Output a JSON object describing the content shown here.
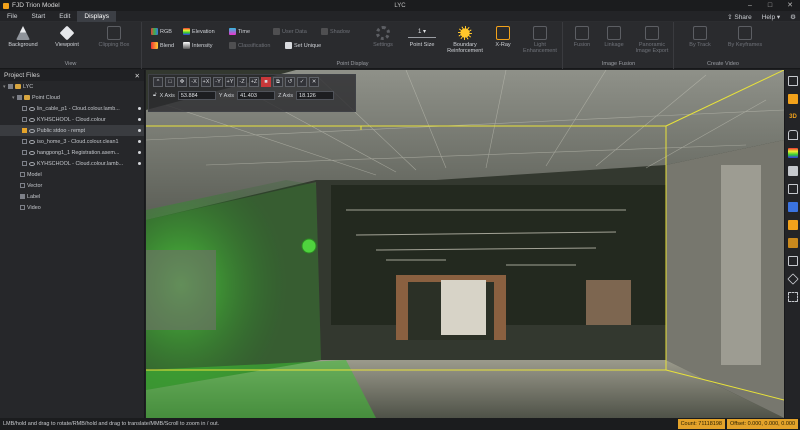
{
  "window": {
    "app_name": "FJD Trion Model",
    "title": "LYC"
  },
  "menu": {
    "items": [
      "File",
      "Start",
      "Edit",
      "Displays"
    ],
    "active": "Displays",
    "share": "Share",
    "help": "Help"
  },
  "ribbon": {
    "view": {
      "label": "View",
      "background": "Background",
      "viewpoint": "Viewpoint",
      "clipping_box": "Clipping Box"
    },
    "point_display": {
      "label": "Point Display",
      "rgb": "RGB",
      "elevation": "Elevation",
      "time": "Time",
      "user_data": "User Data",
      "shadow": "Shadow",
      "blend": "Blend",
      "intensity": "Intensity",
      "classification": "Classification",
      "set_unique": "Set Unique",
      "settings": "Settings",
      "point_size_value": "1",
      "point_size": "Point Size",
      "boundary_reinforcement": "Boundary Reinforcement",
      "xray": "X-Ray",
      "light_enhancement": "Light Enhancement"
    },
    "image_fusion": {
      "label": "Image Fusion",
      "fusion": "Fusion",
      "linkage": "Linkage",
      "panoramic_image_export": "Panoramic Image Export"
    },
    "create_video": {
      "label": "Create Video",
      "by_track": "By Track",
      "by_keyframes": "By Keyframes"
    }
  },
  "project_files": {
    "title": "Project Files",
    "rows": [
      {
        "label": "LYC",
        "depth": 0
      },
      {
        "label": "Point Cloud",
        "depth": 1
      },
      {
        "label": "lin_cable_p1 - Cloud.colour.lamb...",
        "depth": 2
      },
      {
        "label": "KYHSCHOOL - Cloud.colour",
        "depth": 2
      },
      {
        "label": "Public stdoo - rempt",
        "depth": 2
      },
      {
        "label": "iso_home_3 - Cloud.colour.clean1",
        "depth": 2
      },
      {
        "label": "hangpong1_1 Registration.asem...",
        "depth": 2
      },
      {
        "label": "KYHSCHOOL - Cloud.colour.lamb...",
        "depth": 2
      },
      {
        "label": "Model",
        "depth": 1
      },
      {
        "label": "Vector",
        "depth": 1
      },
      {
        "label": "Label",
        "depth": 1
      },
      {
        "label": "Video",
        "depth": 1
      }
    ]
  },
  "clip_toolbar": {
    "buttons": [
      "^",
      "□",
      "✥",
      "-X",
      "+X",
      "-Y",
      "+Y",
      "-Z",
      "+Z",
      "■",
      "⧉",
      "↺",
      "✓",
      "✕"
    ],
    "x_label": "X Axis",
    "x_value": "53.884",
    "y_label": "Y Axis",
    "y_value": "41.403",
    "z_label": "Z Axis",
    "z_value": "18.126"
  },
  "status": {
    "hint": "LMB/hold and drag to rotate/RMB/hold and drag to translate/MMB/Scroll to zoom in / out.",
    "count": "Count: 71118198",
    "offset": "Offset: 0.000, 0.000, 0.000"
  },
  "colors": {
    "accent": "#f2a21b",
    "selection_box": "#e8e23a",
    "green_cloud": "#3ba83a"
  }
}
